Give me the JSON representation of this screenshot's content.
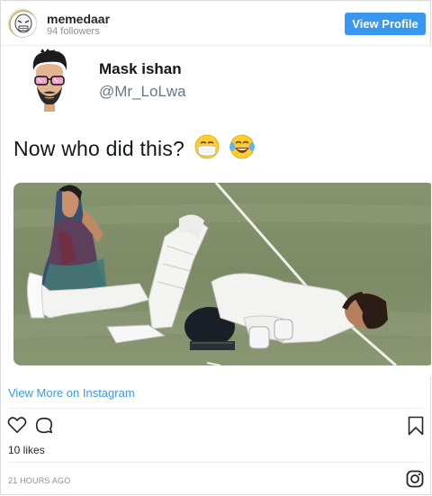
{
  "header": {
    "username": "memedaar",
    "followers": "94 followers",
    "view_profile_label": "View Profile"
  },
  "post": {
    "tweet_name": "Mask ishan",
    "tweet_handle": "@Mr_LoLwa",
    "tweet_text": "Now who did this?",
    "emojis": [
      "face-with-medical-mask-emoji",
      "face-with-tears-of-joy-emoji"
    ],
    "photo": "cricket-player-lying-on-pitch-with-woman-watching"
  },
  "footer": {
    "view_more_label": "View More on Instagram",
    "likes": "10 likes",
    "timestamp": "21 HOURS AGO"
  },
  "icons": {
    "like": "heart-icon",
    "comment": "comment-icon",
    "save": "bookmark-icon",
    "instagram": "instagram-icon"
  },
  "colors": {
    "accent": "#3897f0",
    "text": "#262626",
    "muted": "#8e8e8e"
  }
}
